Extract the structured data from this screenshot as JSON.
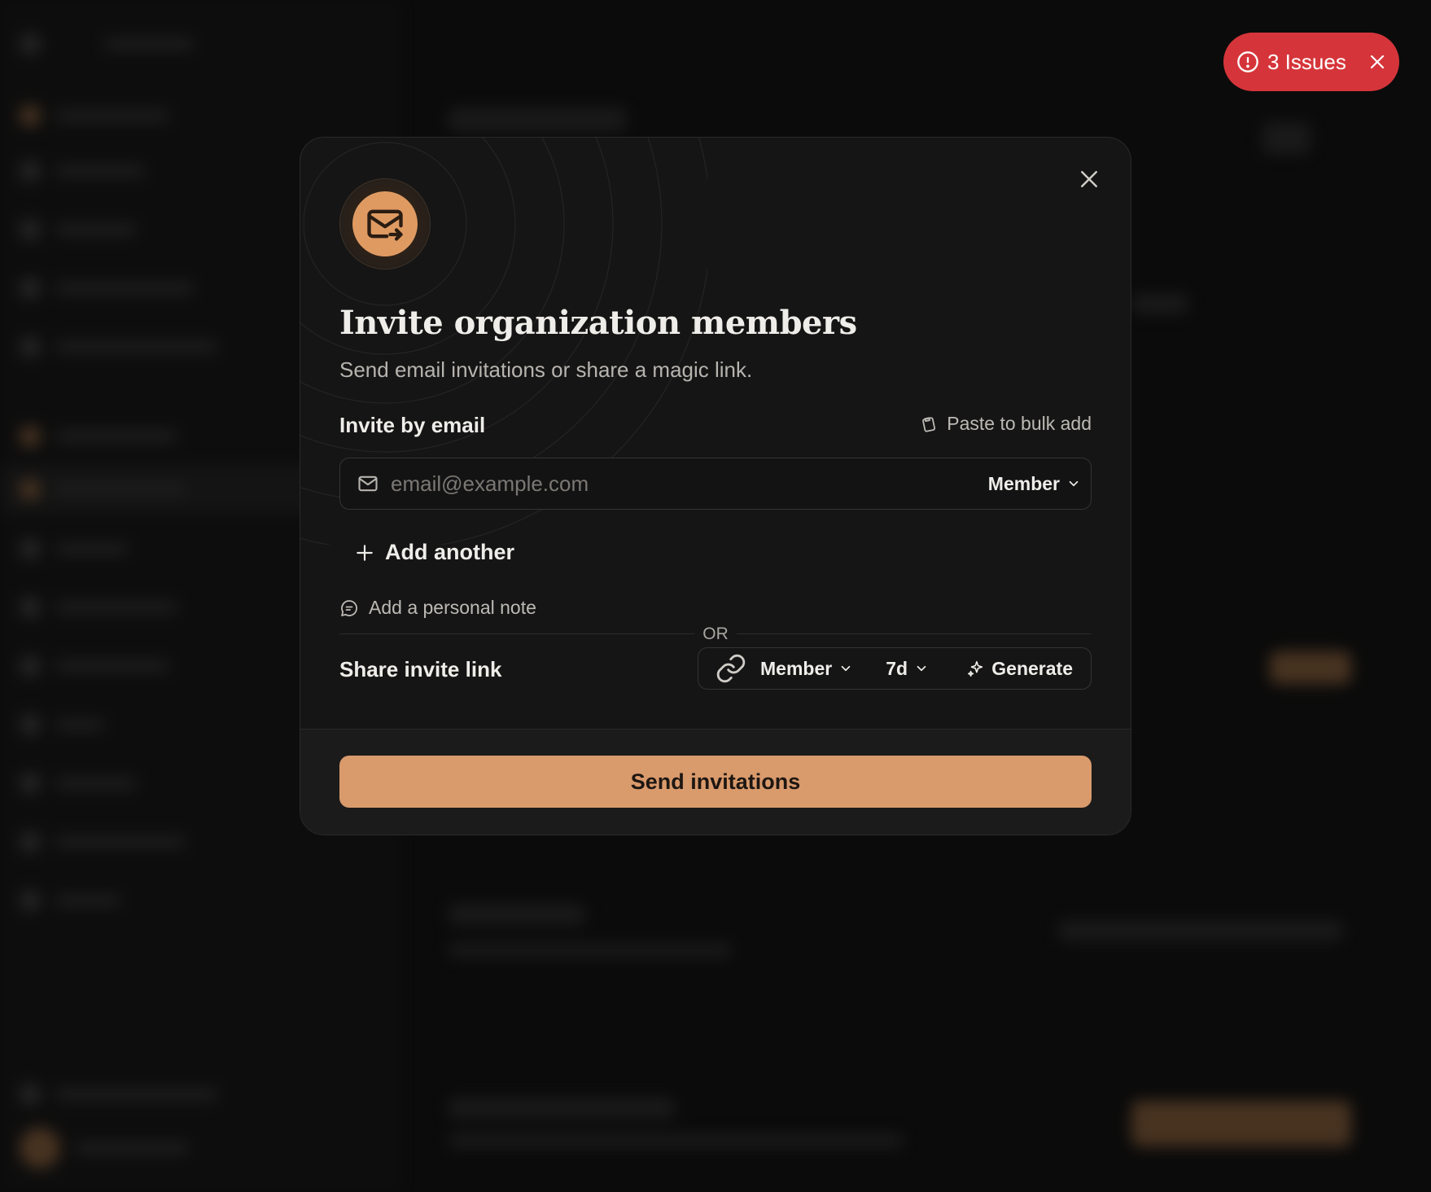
{
  "issues": {
    "label": "3 Issues"
  },
  "modal": {
    "title": "Invite organization members",
    "subtitle": "Send email invitations or share a magic link.",
    "email_section": {
      "label": "Invite by email",
      "paste_bulk": "Paste to bulk add",
      "email_placeholder": "email@example.com",
      "email_value": "",
      "role": "Member",
      "add_another": "Add another",
      "personal_note": "Add a personal note"
    },
    "or_label": "OR",
    "link_section": {
      "label": "Share invite link",
      "role": "Member",
      "expiry": "7d",
      "generate": "Generate"
    },
    "send_button": "Send invitations"
  },
  "colors": {
    "accent": "#d99a6c",
    "issues": "#d5353a",
    "modal_bg": "#151515"
  }
}
